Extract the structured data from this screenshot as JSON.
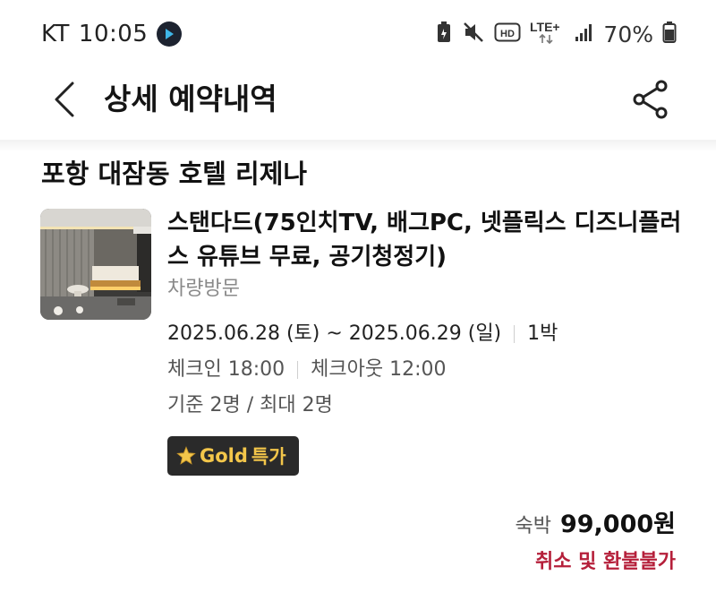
{
  "status_bar": {
    "carrier": "KT",
    "time": "10:05",
    "network": "LTE+",
    "network_sub": "HD",
    "battery_percent": "70%"
  },
  "header": {
    "title": "상세 예약내역",
    "back_icon": "chevron-left-icon",
    "share_icon": "share-icon"
  },
  "hotel": {
    "name": "포항 대잠동 호텔 리제나"
  },
  "room": {
    "name": "스탠다드(75인치TV, 배그PC, 넷플릭스 디즈니플러스 유튜브 무료, 공기청정기)",
    "visit_type": "차량방문",
    "date_range": "2025.06.28 (토) ~ 2025.06.29 (일)",
    "nights": "1박",
    "checkin": "체크인 18:00",
    "checkout": "체크아웃 12:00",
    "capacity": "기준 2명 / 최대 2명",
    "badge": {
      "label": "Gold",
      "suffix": "특가",
      "icon": "star-icon"
    }
  },
  "price": {
    "type": "숙박",
    "amount": "99,000원",
    "refund_policy": "취소 및 환불불가"
  },
  "colors": {
    "refund_red": "#b51f3a",
    "badge_bg": "#2a2a2a",
    "badge_gold": "#f3c64a"
  }
}
